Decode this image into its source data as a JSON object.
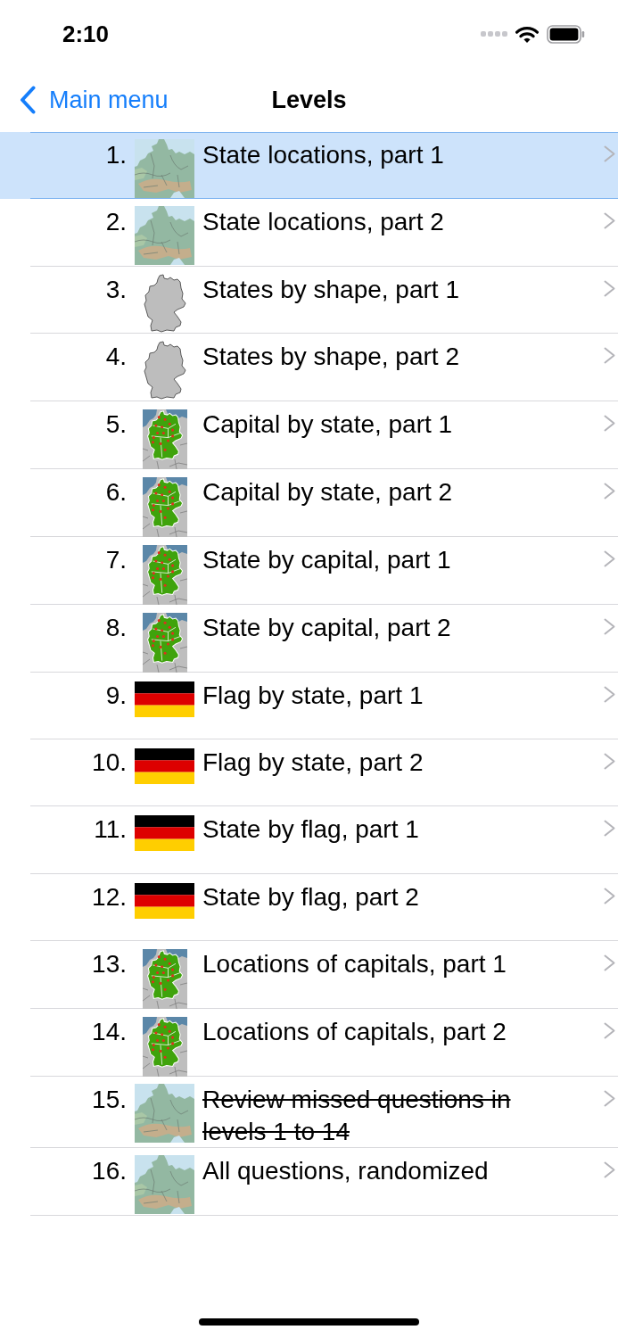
{
  "status_bar": {
    "time": "2:10"
  },
  "nav_bar": {
    "back_label": "Main menu",
    "title": "Levels"
  },
  "levels": [
    {
      "number": "1.",
      "title": "State locations, part 1",
      "kind": "relief_map",
      "selected": true,
      "struck_through": false
    },
    {
      "number": "2.",
      "title": "State locations, part 2",
      "kind": "relief_map",
      "selected": false,
      "struck_through": false
    },
    {
      "number": "3.",
      "title": "States by shape, part 1",
      "kind": "outline_map",
      "selected": false,
      "struck_through": false
    },
    {
      "number": "4.",
      "title": "States by shape, part 2",
      "kind": "outline_map",
      "selected": false,
      "struck_through": false
    },
    {
      "number": "5.",
      "title": "Capital by state, part 1",
      "kind": "capital_map",
      "selected": false,
      "struck_through": false
    },
    {
      "number": "6.",
      "title": "Capital by state, part 2",
      "kind": "capital_map",
      "selected": false,
      "struck_through": false
    },
    {
      "number": "7.",
      "title": "State by capital, part 1",
      "kind": "capital_map",
      "selected": false,
      "struck_through": false
    },
    {
      "number": "8.",
      "title": "State by capital, part 2",
      "kind": "capital_map",
      "selected": false,
      "struck_through": false
    },
    {
      "number": "9.",
      "title": "Flag by state, part 1",
      "kind": "flag",
      "selected": false,
      "struck_through": false
    },
    {
      "number": "10.",
      "title": "Flag by state, part 2",
      "kind": "flag",
      "selected": false,
      "struck_through": false
    },
    {
      "number": "11.",
      "title": "State by flag, part 1",
      "kind": "flag",
      "selected": false,
      "struck_through": false
    },
    {
      "number": "12.",
      "title": "State by flag, part 2",
      "kind": "flag",
      "selected": false,
      "struck_through": false
    },
    {
      "number": "13.",
      "title": "Locations of capitals, part 1",
      "kind": "capital_map",
      "selected": false,
      "struck_through": false
    },
    {
      "number": "14.",
      "title": "Locations of capitals, part 2",
      "kind": "capital_map",
      "selected": false,
      "struck_through": false
    },
    {
      "number": "15.",
      "title": "Review missed questions in levels 1 to 14",
      "kind": "relief_map",
      "selected": false,
      "struck_through": true
    },
    {
      "number": "16.",
      "title": "All questions, randomized",
      "kind": "relief_map",
      "selected": false,
      "struck_through": false
    }
  ]
}
